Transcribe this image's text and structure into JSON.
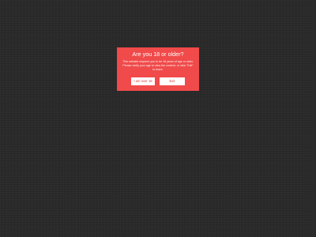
{
  "age_gate": {
    "title": "Are you 18 or older?",
    "message": "This website requires you to be 18 years of age or older. Please verify your age to view the content, or click \"Exit\" to leave.",
    "confirm_label": "I am over 18",
    "exit_label": "Exit"
  },
  "colors": {
    "background": "#2b2b2b",
    "modal": "#f04a4a",
    "button_bg": "#ffffff",
    "button_text": "#e04040"
  }
}
